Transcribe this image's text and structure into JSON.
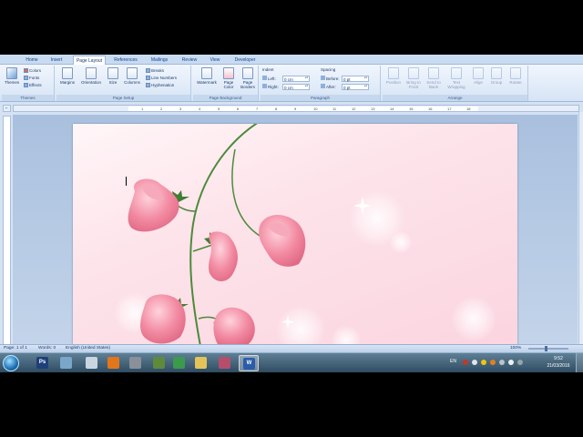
{
  "tabs": [
    "Home",
    "Insert",
    "Page Layout",
    "References",
    "Mailings",
    "Review",
    "View",
    "Developer"
  ],
  "active_tab": "Page Layout",
  "ribbon": {
    "themes": {
      "themes_btn": "Themes",
      "colors": "Colors",
      "fonts": "Fonts",
      "effects": "Effects",
      "label": "Themes"
    },
    "page_setup": {
      "margins": "Margins",
      "orientation": "Orientation",
      "size": "Size",
      "columns": "Columns",
      "breaks": "Breaks",
      "line_numbers": "Line Numbers",
      "hyphenation": "Hyphenation",
      "label": "Page Setup"
    },
    "page_background": {
      "watermark": "Watermark",
      "page_color": "Page Color",
      "page_borders": "Page Borders",
      "label": "Page Background"
    },
    "paragraph": {
      "indent_title": "Indent",
      "left_label": "Left:",
      "left_value": "0 cm",
      "right_label": "Right:",
      "right_value": "0 cm",
      "spacing_title": "Spacing",
      "before_label": "Before:",
      "before_value": "0 pt",
      "after_label": "After:",
      "after_value": "0 pt",
      "label": "Paragraph"
    },
    "arrange": {
      "position": "Position",
      "bring_to_front": "Bring to Front",
      "send_to_back": "Send to Back",
      "text_wrapping": "Text Wrapping",
      "align": "Align",
      "group": "Group",
      "rotate": "Rotate",
      "label": "Arrange"
    }
  },
  "ruler_ticks": [
    "1",
    "2",
    "3",
    "4",
    "5",
    "6",
    "7",
    "8",
    "9",
    "10",
    "11",
    "12",
    "13",
    "14",
    "15",
    "16",
    "17",
    "18"
  ],
  "status": {
    "page": "Page: 1 of 1",
    "words": "Words: 0",
    "language": "English (United States)",
    "zoom": "100%"
  },
  "taskbar": {
    "apps": [
      {
        "name": "photoshop-app",
        "glyph": "Ps",
        "color": "#1f3f7a"
      },
      {
        "name": "explorer-app",
        "glyph": "",
        "color": "#7aa7c9"
      },
      {
        "name": "notepad-app",
        "glyph": "",
        "color": "#c9d6e2"
      },
      {
        "name": "firefox-app",
        "glyph": "",
        "color": "#e2761b"
      },
      {
        "name": "network-app",
        "glyph": "",
        "color": "#8a8f99"
      },
      {
        "name": "gimp-app",
        "glyph": "",
        "color": "#5d8a3c"
      },
      {
        "name": "chrome-app",
        "glyph": "",
        "color": "#3b9a4c"
      },
      {
        "name": "folder-app",
        "glyph": "",
        "color": "#e3c35a"
      },
      {
        "name": "paint-app",
        "glyph": "",
        "color": "#b44e6b"
      },
      {
        "name": "word-app",
        "glyph": "W",
        "color": "#2a5caa"
      }
    ],
    "lang": "EN",
    "time": "9:52",
    "date": "21/03/2016"
  },
  "colors": {
    "page_pink": "#fde3ea",
    "rose": "#f08aa0",
    "leaf": "#4c8a3a"
  }
}
